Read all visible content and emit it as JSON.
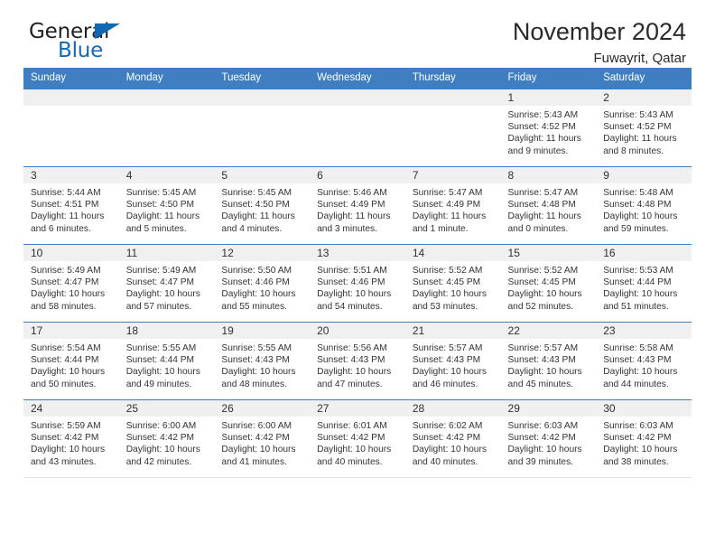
{
  "brand": {
    "name_part1": "General",
    "name_part2": "Blue",
    "triangle_color": "#1268b3"
  },
  "header": {
    "title": "November 2024",
    "subtitle": "Fuwayrit, Qatar"
  },
  "theme": {
    "header_blue": "#3f7fc1",
    "daynum_band": "#f0f0f0",
    "text": "#333333"
  },
  "weekdays": [
    "Sunday",
    "Monday",
    "Tuesday",
    "Wednesday",
    "Thursday",
    "Friday",
    "Saturday"
  ],
  "labels": {
    "sunrise_prefix": "Sunrise:",
    "sunset_prefix": "Sunset:",
    "daylight_prefix": "Daylight:"
  },
  "weeks": [
    [
      {
        "day": "",
        "sunrise": "",
        "sunset": "",
        "daylight_line1": "",
        "daylight_line2": ""
      },
      {
        "day": "",
        "sunrise": "",
        "sunset": "",
        "daylight_line1": "",
        "daylight_line2": ""
      },
      {
        "day": "",
        "sunrise": "",
        "sunset": "",
        "daylight_line1": "",
        "daylight_line2": ""
      },
      {
        "day": "",
        "sunrise": "",
        "sunset": "",
        "daylight_line1": "",
        "daylight_line2": ""
      },
      {
        "day": "",
        "sunrise": "",
        "sunset": "",
        "daylight_line1": "",
        "daylight_line2": ""
      },
      {
        "day": "1",
        "sunrise": "Sunrise: 5:43 AM",
        "sunset": "Sunset: 4:52 PM",
        "daylight_line1": "Daylight: 11 hours",
        "daylight_line2": "and 9 minutes."
      },
      {
        "day": "2",
        "sunrise": "Sunrise: 5:43 AM",
        "sunset": "Sunset: 4:52 PM",
        "daylight_line1": "Daylight: 11 hours",
        "daylight_line2": "and 8 minutes."
      }
    ],
    [
      {
        "day": "3",
        "sunrise": "Sunrise: 5:44 AM",
        "sunset": "Sunset: 4:51 PM",
        "daylight_line1": "Daylight: 11 hours",
        "daylight_line2": "and 6 minutes."
      },
      {
        "day": "4",
        "sunrise": "Sunrise: 5:45 AM",
        "sunset": "Sunset: 4:50 PM",
        "daylight_line1": "Daylight: 11 hours",
        "daylight_line2": "and 5 minutes."
      },
      {
        "day": "5",
        "sunrise": "Sunrise: 5:45 AM",
        "sunset": "Sunset: 4:50 PM",
        "daylight_line1": "Daylight: 11 hours",
        "daylight_line2": "and 4 minutes."
      },
      {
        "day": "6",
        "sunrise": "Sunrise: 5:46 AM",
        "sunset": "Sunset: 4:49 PM",
        "daylight_line1": "Daylight: 11 hours",
        "daylight_line2": "and 3 minutes."
      },
      {
        "day": "7",
        "sunrise": "Sunrise: 5:47 AM",
        "sunset": "Sunset: 4:49 PM",
        "daylight_line1": "Daylight: 11 hours",
        "daylight_line2": "and 1 minute."
      },
      {
        "day": "8",
        "sunrise": "Sunrise: 5:47 AM",
        "sunset": "Sunset: 4:48 PM",
        "daylight_line1": "Daylight: 11 hours",
        "daylight_line2": "and 0 minutes."
      },
      {
        "day": "9",
        "sunrise": "Sunrise: 5:48 AM",
        "sunset": "Sunset: 4:48 PM",
        "daylight_line1": "Daylight: 10 hours",
        "daylight_line2": "and 59 minutes."
      }
    ],
    [
      {
        "day": "10",
        "sunrise": "Sunrise: 5:49 AM",
        "sunset": "Sunset: 4:47 PM",
        "daylight_line1": "Daylight: 10 hours",
        "daylight_line2": "and 58 minutes."
      },
      {
        "day": "11",
        "sunrise": "Sunrise: 5:49 AM",
        "sunset": "Sunset: 4:47 PM",
        "daylight_line1": "Daylight: 10 hours",
        "daylight_line2": "and 57 minutes."
      },
      {
        "day": "12",
        "sunrise": "Sunrise: 5:50 AM",
        "sunset": "Sunset: 4:46 PM",
        "daylight_line1": "Daylight: 10 hours",
        "daylight_line2": "and 55 minutes."
      },
      {
        "day": "13",
        "sunrise": "Sunrise: 5:51 AM",
        "sunset": "Sunset: 4:46 PM",
        "daylight_line1": "Daylight: 10 hours",
        "daylight_line2": "and 54 minutes."
      },
      {
        "day": "14",
        "sunrise": "Sunrise: 5:52 AM",
        "sunset": "Sunset: 4:45 PM",
        "daylight_line1": "Daylight: 10 hours",
        "daylight_line2": "and 53 minutes."
      },
      {
        "day": "15",
        "sunrise": "Sunrise: 5:52 AM",
        "sunset": "Sunset: 4:45 PM",
        "daylight_line1": "Daylight: 10 hours",
        "daylight_line2": "and 52 minutes."
      },
      {
        "day": "16",
        "sunrise": "Sunrise: 5:53 AM",
        "sunset": "Sunset: 4:44 PM",
        "daylight_line1": "Daylight: 10 hours",
        "daylight_line2": "and 51 minutes."
      }
    ],
    [
      {
        "day": "17",
        "sunrise": "Sunrise: 5:54 AM",
        "sunset": "Sunset: 4:44 PM",
        "daylight_line1": "Daylight: 10 hours",
        "daylight_line2": "and 50 minutes."
      },
      {
        "day": "18",
        "sunrise": "Sunrise: 5:55 AM",
        "sunset": "Sunset: 4:44 PM",
        "daylight_line1": "Daylight: 10 hours",
        "daylight_line2": "and 49 minutes."
      },
      {
        "day": "19",
        "sunrise": "Sunrise: 5:55 AM",
        "sunset": "Sunset: 4:43 PM",
        "daylight_line1": "Daylight: 10 hours",
        "daylight_line2": "and 48 minutes."
      },
      {
        "day": "20",
        "sunrise": "Sunrise: 5:56 AM",
        "sunset": "Sunset: 4:43 PM",
        "daylight_line1": "Daylight: 10 hours",
        "daylight_line2": "and 47 minutes."
      },
      {
        "day": "21",
        "sunrise": "Sunrise: 5:57 AM",
        "sunset": "Sunset: 4:43 PM",
        "daylight_line1": "Daylight: 10 hours",
        "daylight_line2": "and 46 minutes."
      },
      {
        "day": "22",
        "sunrise": "Sunrise: 5:57 AM",
        "sunset": "Sunset: 4:43 PM",
        "daylight_line1": "Daylight: 10 hours",
        "daylight_line2": "and 45 minutes."
      },
      {
        "day": "23",
        "sunrise": "Sunrise: 5:58 AM",
        "sunset": "Sunset: 4:43 PM",
        "daylight_line1": "Daylight: 10 hours",
        "daylight_line2": "and 44 minutes."
      }
    ],
    [
      {
        "day": "24",
        "sunrise": "Sunrise: 5:59 AM",
        "sunset": "Sunset: 4:42 PM",
        "daylight_line1": "Daylight: 10 hours",
        "daylight_line2": "and 43 minutes."
      },
      {
        "day": "25",
        "sunrise": "Sunrise: 6:00 AM",
        "sunset": "Sunset: 4:42 PM",
        "daylight_line1": "Daylight: 10 hours",
        "daylight_line2": "and 42 minutes."
      },
      {
        "day": "26",
        "sunrise": "Sunrise: 6:00 AM",
        "sunset": "Sunset: 4:42 PM",
        "daylight_line1": "Daylight: 10 hours",
        "daylight_line2": "and 41 minutes."
      },
      {
        "day": "27",
        "sunrise": "Sunrise: 6:01 AM",
        "sunset": "Sunset: 4:42 PM",
        "daylight_line1": "Daylight: 10 hours",
        "daylight_line2": "and 40 minutes."
      },
      {
        "day": "28",
        "sunrise": "Sunrise: 6:02 AM",
        "sunset": "Sunset: 4:42 PM",
        "daylight_line1": "Daylight: 10 hours",
        "daylight_line2": "and 40 minutes."
      },
      {
        "day": "29",
        "sunrise": "Sunrise: 6:03 AM",
        "sunset": "Sunset: 4:42 PM",
        "daylight_line1": "Daylight: 10 hours",
        "daylight_line2": "and 39 minutes."
      },
      {
        "day": "30",
        "sunrise": "Sunrise: 6:03 AM",
        "sunset": "Sunset: 4:42 PM",
        "daylight_line1": "Daylight: 10 hours",
        "daylight_line2": "and 38 minutes."
      }
    ]
  ]
}
